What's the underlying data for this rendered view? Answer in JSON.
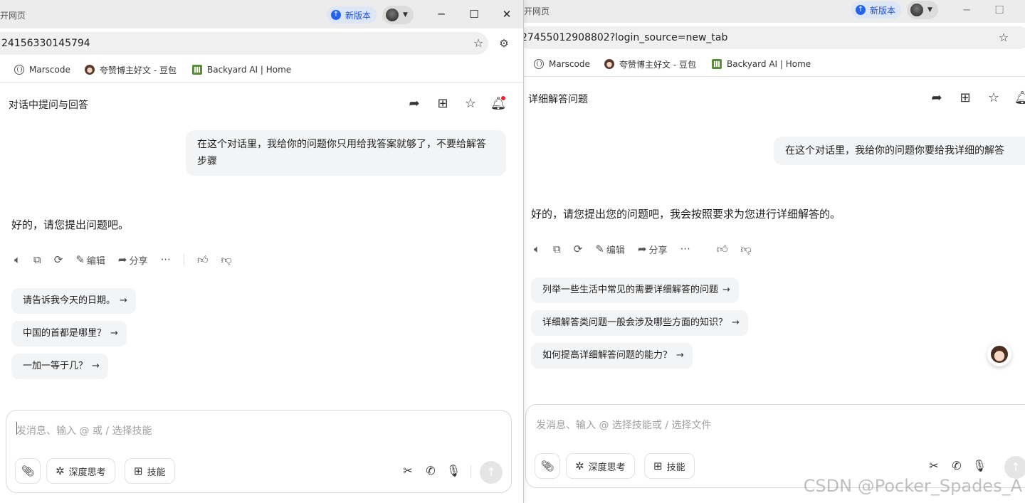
{
  "left": {
    "window_title": "打开网页",
    "new_version_label": "新版本",
    "url": "24156330145794",
    "bookmarks": [
      "Marscode",
      "夸赞博主好文 - 豆包",
      "Backyard AI | Home"
    ],
    "conversation_title": "对话中提问与回答",
    "user_message": "在这个对话里，我给你的问题你只用给我答案就够了，不要给解答步骤",
    "answer": "好的，请您提出问题吧。",
    "actions": {
      "edit": "编辑",
      "share": "分享"
    },
    "suggestions": [
      "请告诉我今天的日期。",
      "中国的首都是哪里？",
      "一加一等于几？"
    ],
    "input_placeholder": "发消息、输入 @ 或 / 选择技能",
    "deep_think_label": "深度思考",
    "skills_label": "技能"
  },
  "right": {
    "window_title": "开网页",
    "new_version_label": "新版本",
    "url": "27455012908802?login_source=new_tab",
    "bookmarks": [
      "Marscode",
      "夸赞博主好文 - 豆包",
      "Backyard AI | Home"
    ],
    "conversation_title": "详细解答问题",
    "user_message": "在这个对话里，我给你的问题你要给我详细的解答",
    "answer": "好的，请您提出您的问题吧，我会按照要求为您进行详细解答的。",
    "actions": {
      "edit": "编辑",
      "share": "分享"
    },
    "suggestions": [
      "列举一些生活中常见的需要详细解答的问题",
      "详细解答类问题一般会涉及哪些方面的知识？",
      "如何提高详细解答问题的能力？"
    ],
    "input_placeholder": "发消息、输入 @ 选择技能或 / 选择文件",
    "deep_think_label": "深度思考",
    "skills_label": "技能"
  },
  "watermark": "CSDN @Pocker_Spades_A",
  "icons": {
    "share": "share-arrow-icon",
    "save": "save-tray-icon",
    "star": "star-icon",
    "bell": "bell-icon",
    "speaker": "speaker-icon",
    "copy": "copy-icon",
    "regenerate": "refresh-icon",
    "edit": "edit-pen-icon",
    "more": "more-icon",
    "like": "thumbs-up-icon",
    "dislike": "thumbs-down-icon",
    "attach": "paperclip-icon",
    "deep_think": "atom-icon",
    "skills": "grid-plus-icon",
    "scissors": "scissors-icon",
    "phone": "phone-icon",
    "mic": "microphone-icon",
    "send": "send-arrow-icon"
  },
  "colors": {
    "accent": "#2563eb",
    "bubble": "#f3f4f6",
    "notify": "#f5222d",
    "titlebar": "#ececec"
  }
}
